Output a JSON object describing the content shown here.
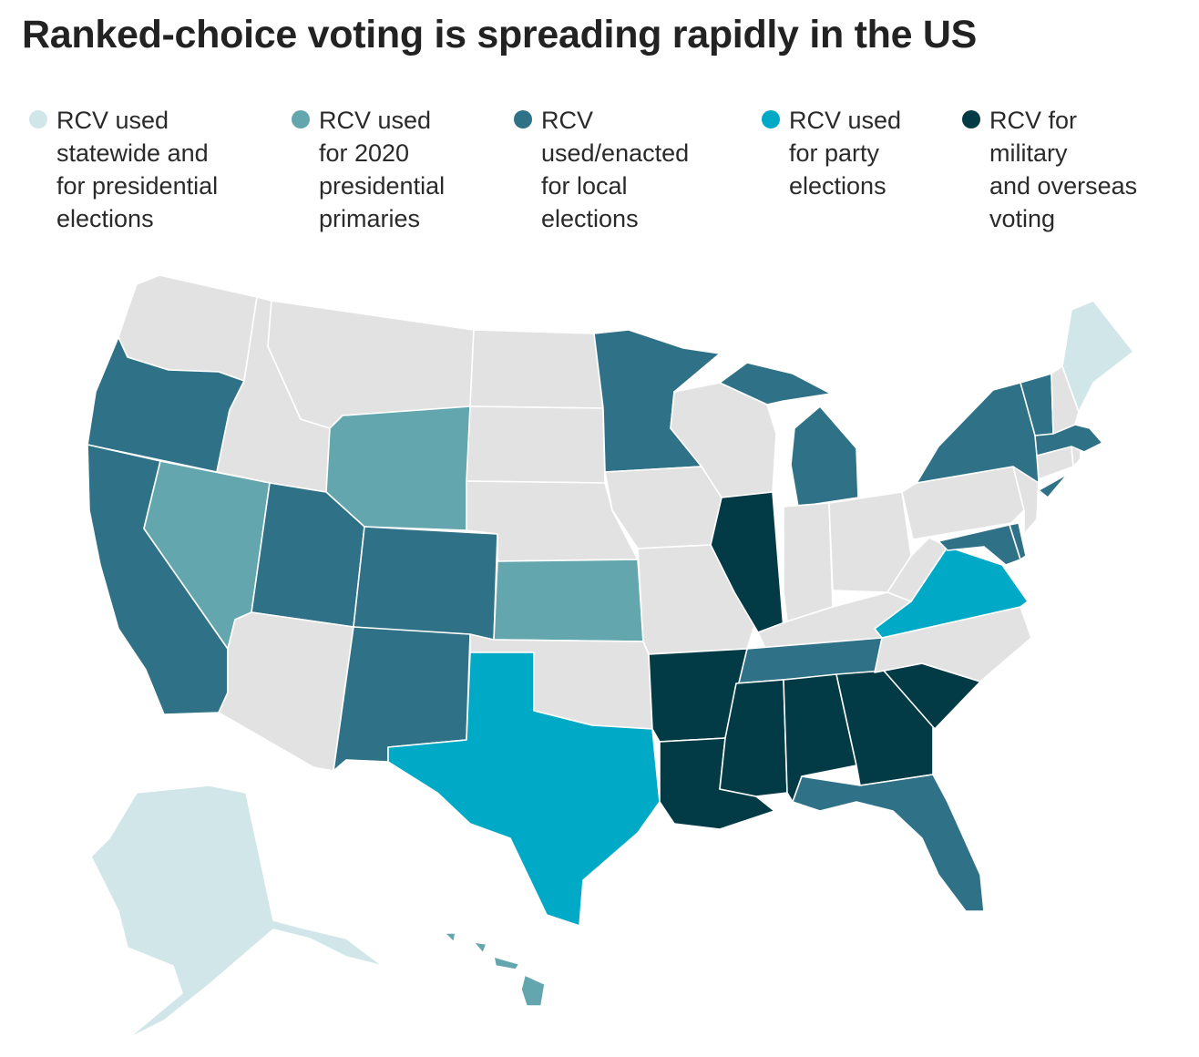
{
  "title": "Ranked-choice voting is spreading rapidly in the US",
  "colors": {
    "none": "#e2e2e2",
    "statewide": "#d1e6e8",
    "primaries_2020": "#64a6ae",
    "local": "#2f7186",
    "party": "#00a9c5",
    "military_overseas": "#023a46"
  },
  "legend": [
    {
      "key": "statewide",
      "label": "RCV used\nstatewide and\nfor presidential\nelections",
      "color": "#d1e6e8"
    },
    {
      "key": "primaries_2020",
      "label": "RCV used\nfor 2020\npresidential\nprimaries",
      "color": "#64a6ae"
    },
    {
      "key": "local",
      "label": "RCV\nused/enacted\nfor local\nelections",
      "color": "#2f7186"
    },
    {
      "key": "party",
      "label": "RCV used\nfor party\nelections",
      "color": "#00a9c5"
    },
    {
      "key": "military_overseas",
      "label": "RCV for\nmilitary\nand overseas\nvoting",
      "color": "#023a46"
    }
  ],
  "chart_data": {
    "type": "choropleth",
    "title": "Ranked-choice voting is spreading rapidly in the US",
    "categories": {
      "statewide": [
        "Maine",
        "Alaska"
      ],
      "primaries_2020": [
        "Wyoming",
        "Nevada",
        "Kansas",
        "Hawaii"
      ],
      "local": [
        "Oregon",
        "California",
        "Utah",
        "Colorado",
        "New Mexico",
        "Minnesota",
        "Michigan",
        "Tennessee",
        "Florida",
        "New York",
        "Vermont",
        "Massachusetts",
        "Maryland",
        "Delaware"
      ],
      "party": [
        "Texas",
        "Virginia"
      ],
      "military_overseas": [
        "Illinois",
        "Arkansas",
        "Louisiana",
        "Mississippi",
        "Alabama",
        "Georgia",
        "South Carolina"
      ],
      "none": [
        "Washington",
        "Idaho",
        "Montana",
        "North Dakota",
        "South Dakota",
        "Nebraska",
        "Iowa",
        "Wisconsin",
        "Missouri",
        "Oklahoma",
        "Arizona",
        "Indiana",
        "Ohio",
        "Kentucky",
        "West Virginia",
        "North Carolina",
        "Pennsylvania",
        "New Jersey",
        "Connecticut",
        "Rhode Island",
        "New Hampshire"
      ]
    },
    "legend_position": "top"
  }
}
